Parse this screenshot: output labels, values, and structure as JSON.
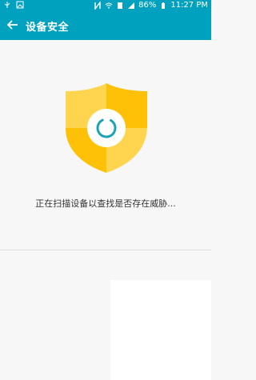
{
  "status_bar": {
    "battery": "86%",
    "time": "11:27 PM",
    "left_icons": [
      "usb-icon",
      "image-icon"
    ],
    "right_icons": [
      "nfc-icon",
      "wifi-icon",
      "sim-icon",
      "signal-icon",
      "battery-icon"
    ]
  },
  "app_bar": {
    "title": "设备安全",
    "back_icon": "back-arrow-icon"
  },
  "main": {
    "shield_icon": "security-shield-icon",
    "spinner_icon": "scan-spinner-icon",
    "scan_message": "正在扫描设备以查找是否存在威胁..."
  },
  "colors": {
    "accent": "#00a0bf",
    "shield_light": "#ffd54f",
    "shield_dark": "#ffc107",
    "spinner": "#1ba3b3"
  }
}
